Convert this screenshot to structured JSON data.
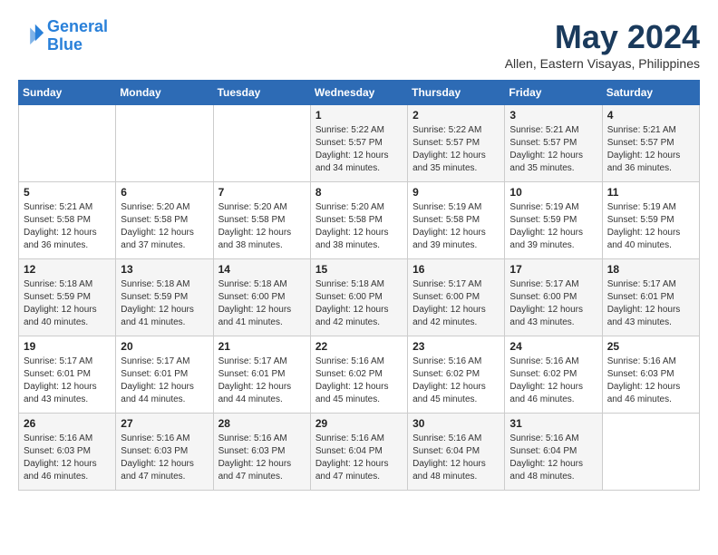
{
  "logo": {
    "line1": "General",
    "line2": "Blue"
  },
  "title": "May 2024",
  "location": "Allen, Eastern Visayas, Philippines",
  "weekdays": [
    "Sunday",
    "Monday",
    "Tuesday",
    "Wednesday",
    "Thursday",
    "Friday",
    "Saturday"
  ],
  "weeks": [
    [
      {
        "day": "",
        "sunrise": "",
        "sunset": "",
        "daylight": ""
      },
      {
        "day": "",
        "sunrise": "",
        "sunset": "",
        "daylight": ""
      },
      {
        "day": "",
        "sunrise": "",
        "sunset": "",
        "daylight": ""
      },
      {
        "day": "1",
        "sunrise": "Sunrise: 5:22 AM",
        "sunset": "Sunset: 5:57 PM",
        "daylight": "Daylight: 12 hours and 34 minutes."
      },
      {
        "day": "2",
        "sunrise": "Sunrise: 5:22 AM",
        "sunset": "Sunset: 5:57 PM",
        "daylight": "Daylight: 12 hours and 35 minutes."
      },
      {
        "day": "3",
        "sunrise": "Sunrise: 5:21 AM",
        "sunset": "Sunset: 5:57 PM",
        "daylight": "Daylight: 12 hours and 35 minutes."
      },
      {
        "day": "4",
        "sunrise": "Sunrise: 5:21 AM",
        "sunset": "Sunset: 5:57 PM",
        "daylight": "Daylight: 12 hours and 36 minutes."
      }
    ],
    [
      {
        "day": "5",
        "sunrise": "Sunrise: 5:21 AM",
        "sunset": "Sunset: 5:58 PM",
        "daylight": "Daylight: 12 hours and 36 minutes."
      },
      {
        "day": "6",
        "sunrise": "Sunrise: 5:20 AM",
        "sunset": "Sunset: 5:58 PM",
        "daylight": "Daylight: 12 hours and 37 minutes."
      },
      {
        "day": "7",
        "sunrise": "Sunrise: 5:20 AM",
        "sunset": "Sunset: 5:58 PM",
        "daylight": "Daylight: 12 hours and 38 minutes."
      },
      {
        "day": "8",
        "sunrise": "Sunrise: 5:20 AM",
        "sunset": "Sunset: 5:58 PM",
        "daylight": "Daylight: 12 hours and 38 minutes."
      },
      {
        "day": "9",
        "sunrise": "Sunrise: 5:19 AM",
        "sunset": "Sunset: 5:58 PM",
        "daylight": "Daylight: 12 hours and 39 minutes."
      },
      {
        "day": "10",
        "sunrise": "Sunrise: 5:19 AM",
        "sunset": "Sunset: 5:59 PM",
        "daylight": "Daylight: 12 hours and 39 minutes."
      },
      {
        "day": "11",
        "sunrise": "Sunrise: 5:19 AM",
        "sunset": "Sunset: 5:59 PM",
        "daylight": "Daylight: 12 hours and 40 minutes."
      }
    ],
    [
      {
        "day": "12",
        "sunrise": "Sunrise: 5:18 AM",
        "sunset": "Sunset: 5:59 PM",
        "daylight": "Daylight: 12 hours and 40 minutes."
      },
      {
        "day": "13",
        "sunrise": "Sunrise: 5:18 AM",
        "sunset": "Sunset: 5:59 PM",
        "daylight": "Daylight: 12 hours and 41 minutes."
      },
      {
        "day": "14",
        "sunrise": "Sunrise: 5:18 AM",
        "sunset": "Sunset: 6:00 PM",
        "daylight": "Daylight: 12 hours and 41 minutes."
      },
      {
        "day": "15",
        "sunrise": "Sunrise: 5:18 AM",
        "sunset": "Sunset: 6:00 PM",
        "daylight": "Daylight: 12 hours and 42 minutes."
      },
      {
        "day": "16",
        "sunrise": "Sunrise: 5:17 AM",
        "sunset": "Sunset: 6:00 PM",
        "daylight": "Daylight: 12 hours and 42 minutes."
      },
      {
        "day": "17",
        "sunrise": "Sunrise: 5:17 AM",
        "sunset": "Sunset: 6:00 PM",
        "daylight": "Daylight: 12 hours and 43 minutes."
      },
      {
        "day": "18",
        "sunrise": "Sunrise: 5:17 AM",
        "sunset": "Sunset: 6:01 PM",
        "daylight": "Daylight: 12 hours and 43 minutes."
      }
    ],
    [
      {
        "day": "19",
        "sunrise": "Sunrise: 5:17 AM",
        "sunset": "Sunset: 6:01 PM",
        "daylight": "Daylight: 12 hours and 43 minutes."
      },
      {
        "day": "20",
        "sunrise": "Sunrise: 5:17 AM",
        "sunset": "Sunset: 6:01 PM",
        "daylight": "Daylight: 12 hours and 44 minutes."
      },
      {
        "day": "21",
        "sunrise": "Sunrise: 5:17 AM",
        "sunset": "Sunset: 6:01 PM",
        "daylight": "Daylight: 12 hours and 44 minutes."
      },
      {
        "day": "22",
        "sunrise": "Sunrise: 5:16 AM",
        "sunset": "Sunset: 6:02 PM",
        "daylight": "Daylight: 12 hours and 45 minutes."
      },
      {
        "day": "23",
        "sunrise": "Sunrise: 5:16 AM",
        "sunset": "Sunset: 6:02 PM",
        "daylight": "Daylight: 12 hours and 45 minutes."
      },
      {
        "day": "24",
        "sunrise": "Sunrise: 5:16 AM",
        "sunset": "Sunset: 6:02 PM",
        "daylight": "Daylight: 12 hours and 46 minutes."
      },
      {
        "day": "25",
        "sunrise": "Sunrise: 5:16 AM",
        "sunset": "Sunset: 6:03 PM",
        "daylight": "Daylight: 12 hours and 46 minutes."
      }
    ],
    [
      {
        "day": "26",
        "sunrise": "Sunrise: 5:16 AM",
        "sunset": "Sunset: 6:03 PM",
        "daylight": "Daylight: 12 hours and 46 minutes."
      },
      {
        "day": "27",
        "sunrise": "Sunrise: 5:16 AM",
        "sunset": "Sunset: 6:03 PM",
        "daylight": "Daylight: 12 hours and 47 minutes."
      },
      {
        "day": "28",
        "sunrise": "Sunrise: 5:16 AM",
        "sunset": "Sunset: 6:03 PM",
        "daylight": "Daylight: 12 hours and 47 minutes."
      },
      {
        "day": "29",
        "sunrise": "Sunrise: 5:16 AM",
        "sunset": "Sunset: 6:04 PM",
        "daylight": "Daylight: 12 hours and 47 minutes."
      },
      {
        "day": "30",
        "sunrise": "Sunrise: 5:16 AM",
        "sunset": "Sunset: 6:04 PM",
        "daylight": "Daylight: 12 hours and 48 minutes."
      },
      {
        "day": "31",
        "sunrise": "Sunrise: 5:16 AM",
        "sunset": "Sunset: 6:04 PM",
        "daylight": "Daylight: 12 hours and 48 minutes."
      },
      {
        "day": "",
        "sunrise": "",
        "sunset": "",
        "daylight": ""
      }
    ]
  ]
}
